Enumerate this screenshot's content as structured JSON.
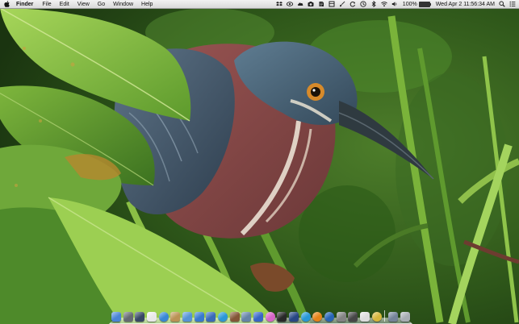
{
  "menubar": {
    "apple_icon": "apple-logo-icon",
    "app_name": "Finder",
    "menus": [
      "File",
      "Edit",
      "View",
      "Go",
      "Window",
      "Help"
    ],
    "status_icons": [
      "dropbox-icon",
      "eye-icon",
      "cloud-icon",
      "camera-icon",
      "evernote-icon",
      "box-icon",
      "paintbrush-icon",
      "sync-icon",
      "timemachine-icon",
      "bluetooth-icon",
      "wifi-icon",
      "volume-icon"
    ],
    "battery_label": "100%",
    "battery_level": 1.0,
    "date_time": "Wed Apr 2  11:56:34 AM",
    "search_icon": "spotlight-search-icon",
    "list_icon": "notification-center-icon"
  },
  "desktop": {
    "wallpaper": "green-heron-among-leaves",
    "colors": {
      "background": "#2f5a1d",
      "leaf_light": "#8cc43e",
      "leaf_dark": "#3d6e22",
      "bird_chest": "#8e4a4a",
      "bird_head": "#4a6478"
    }
  },
  "dock": {
    "apps": [
      {
        "name": "finder-icon",
        "color": "#4d8be0"
      },
      {
        "name": "launchpad-icon",
        "color": "#6a6f78"
      },
      {
        "name": "mission-control-icon",
        "color": "#3a4a6a"
      },
      {
        "name": "calendar-icon",
        "color": "#f4f4f4"
      },
      {
        "name": "safari-icon",
        "color": "#3b8ee0"
      },
      {
        "name": "contacts-icon",
        "color": "#c49a5a"
      },
      {
        "name": "mail-icon",
        "color": "#5a9be0"
      },
      {
        "name": "app-store-icon",
        "color": "#3a7fd8"
      },
      {
        "name": "xcode-icon",
        "color": "#3c6fc2"
      },
      {
        "name": "itunes-icon",
        "color": "#2e9fe0"
      },
      {
        "name": "photos-icon",
        "color": "#8a5a3a"
      },
      {
        "name": "preview-icon",
        "color": "#6a8ab0"
      },
      {
        "name": "keynote-icon",
        "color": "#3a6ad0"
      },
      {
        "name": "game-center-icon",
        "color": "#e06ad0"
      },
      {
        "name": "terminal-icon",
        "color": "#2a2a2a"
      },
      {
        "name": "quicktime-icon",
        "color": "#2a4a8a"
      },
      {
        "name": "skype-icon",
        "color": "#2aa0e0"
      },
      {
        "name": "vlc-icon",
        "color": "#f08a1a"
      },
      {
        "name": "dashboard-icon",
        "color": "#2a6ac0"
      },
      {
        "name": "system-preferences-icon",
        "color": "#8a8a8a"
      },
      {
        "name": "activity-monitor-icon",
        "color": "#4a4a4a"
      },
      {
        "name": "textedit-icon",
        "color": "#e8e8e8"
      },
      {
        "name": "chrome-icon",
        "color": "#e0c040"
      },
      {
        "name": "downloads-stack-icon",
        "color": "#7a8aa0"
      },
      {
        "name": "trash-icon",
        "color": "#b0b6bc"
      }
    ],
    "separator_after_index": 22
  }
}
